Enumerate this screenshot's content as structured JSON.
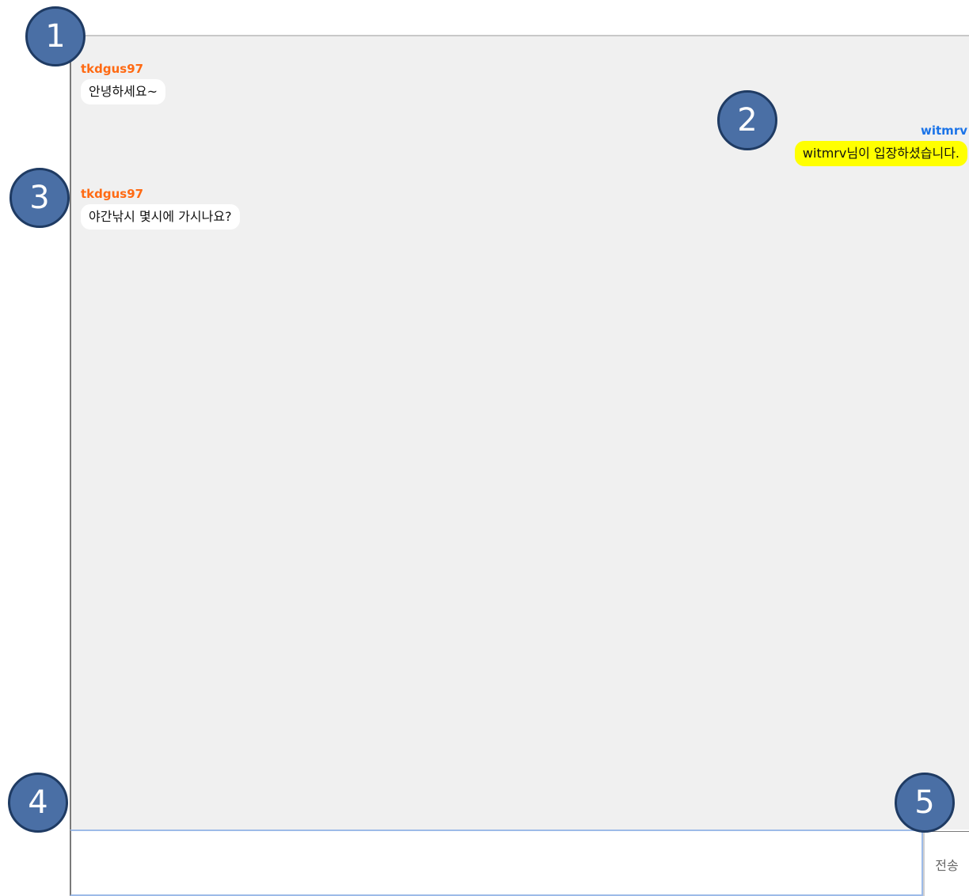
{
  "messages": [
    {
      "sender": "tkdgus97",
      "text": "안녕하세요~",
      "side": "left",
      "sender_color": "#ff6a13",
      "bubble_color": "#ffffff"
    },
    {
      "sender": "witmrv",
      "text": "witmrv님이 입장하셨습니다.",
      "side": "right",
      "sender_color": "#1a73e8",
      "bubble_color": "#ffff00"
    },
    {
      "sender": "tkdgus97",
      "text": "야간낚시 몇시에 가시나요?",
      "side": "left",
      "sender_color": "#ff6a13",
      "bubble_color": "#ffffff"
    }
  ],
  "input": {
    "value": "",
    "placeholder": ""
  },
  "send_button": {
    "label": "전송"
  },
  "markers": [
    "1",
    "2",
    "3",
    "4",
    "5"
  ]
}
